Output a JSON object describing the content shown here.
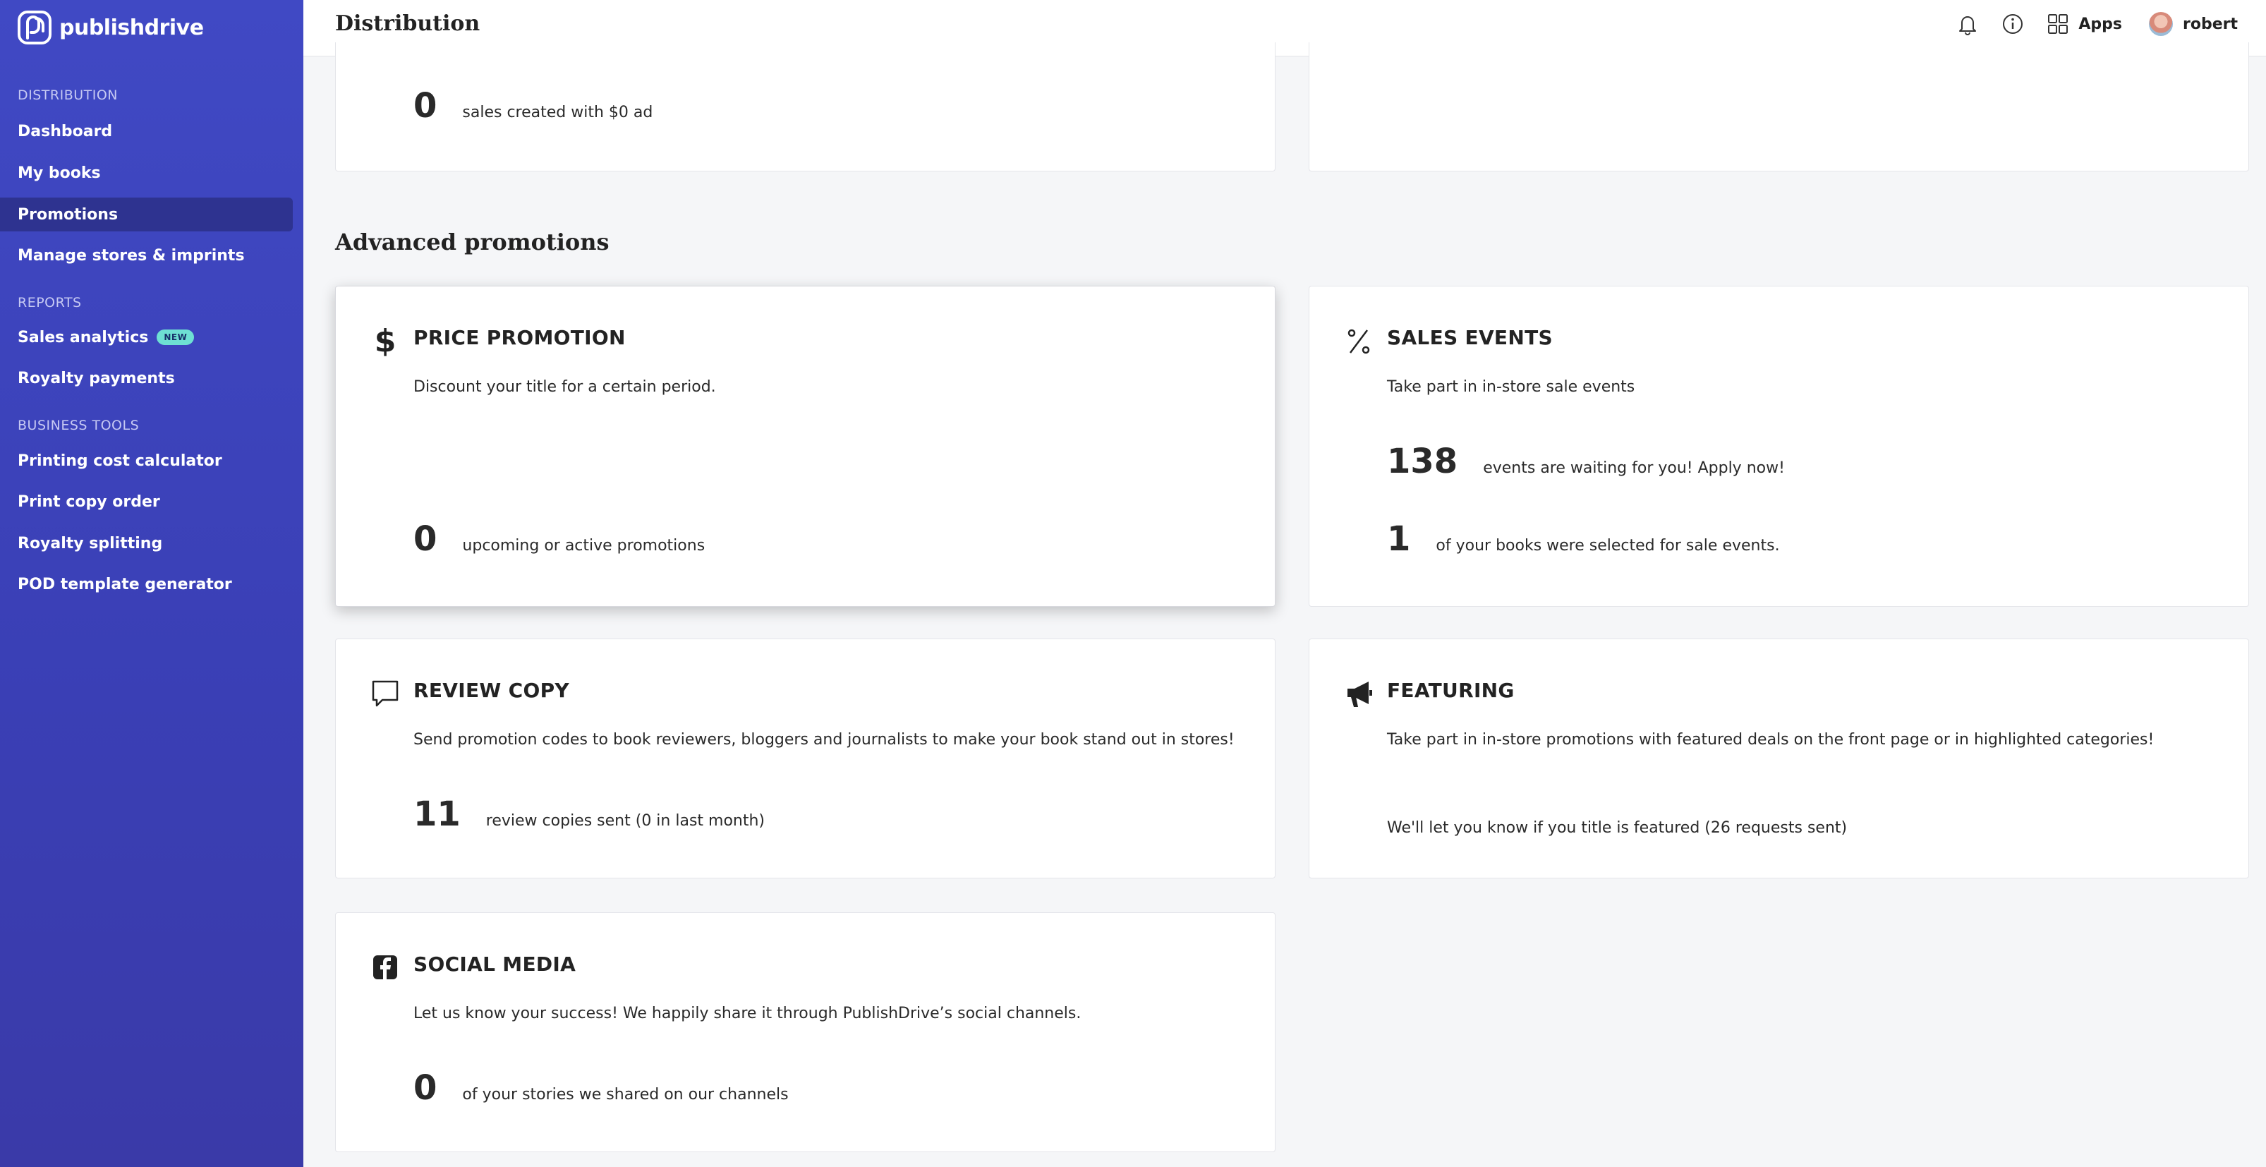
{
  "brand": {
    "name": "publishdrive"
  },
  "sidebar": {
    "sections": [
      {
        "label": "DISTRIBUTION"
      },
      {
        "label": "REPORTS"
      },
      {
        "label": "BUSINESS TOOLS"
      }
    ],
    "items": [
      {
        "label": "Dashboard"
      },
      {
        "label": "My books"
      },
      {
        "label": "Promotions"
      },
      {
        "label": "Manage stores & imprints"
      },
      {
        "label": "Sales analytics",
        "badge": "NEW"
      },
      {
        "label": "Royalty payments"
      },
      {
        "label": "Printing cost calculator"
      },
      {
        "label": "Print copy order"
      },
      {
        "label": "Royalty splitting"
      },
      {
        "label": "POD template generator"
      }
    ]
  },
  "header": {
    "title": "Distribution",
    "apps_label": "Apps",
    "user_name": "robert"
  },
  "top_card": {
    "number": "0",
    "text": "sales created with $0 ad"
  },
  "advanced": {
    "title": "Advanced promotions",
    "price_promotion": {
      "title": "PRICE PROMOTION",
      "desc": "Discount your title for a certain period.",
      "number": "0",
      "text": "upcoming or active promotions"
    },
    "sales_events": {
      "title": "SALES EVENTS",
      "desc": "Take part in in-store sale events",
      "number1": "138",
      "text1": "events are waiting for you! Apply now!",
      "number2": "1",
      "text2": "of your books were selected for sale events."
    },
    "review_copy": {
      "title": "REVIEW COPY",
      "desc": "Send promotion codes to book reviewers, bloggers and journalists to make your book stand out in stores!",
      "number": "11",
      "text": "review copies sent (0 in last month)"
    },
    "featuring": {
      "title": "FEATURING",
      "desc": "Take part in in-store promotions with featured deals on the front page or in highlighted categories!",
      "note": "We'll let you know if you title is featured (26 requests sent)"
    },
    "social_media": {
      "title": "SOCIAL MEDIA",
      "desc": "Let us know your success! We happily share it through PublishDrive’s social channels.",
      "number": "0",
      "text": "of your stories we shared on our channels"
    }
  },
  "colors": {
    "sidebar": "#3d44bd",
    "active_item": "#2e3390",
    "badge": "#6ee0d3"
  }
}
